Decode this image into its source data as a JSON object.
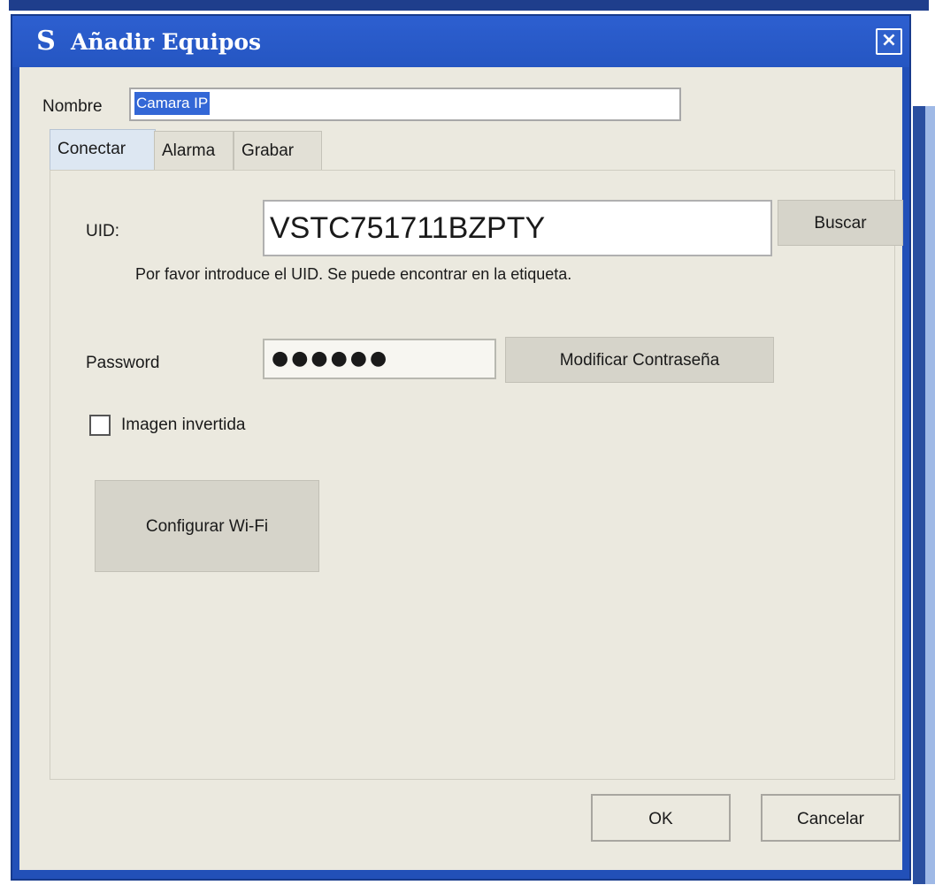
{
  "window": {
    "title": "Añadir Equipos",
    "app_icon": "S",
    "close_symbol": "×"
  },
  "form": {
    "name_label": "Nombre",
    "name_value": "Camara IP"
  },
  "tabs": [
    {
      "label": "Conectar",
      "active": true
    },
    {
      "label": "Alarma",
      "active": false
    },
    {
      "label": "Grabar",
      "active": false
    }
  ],
  "connect": {
    "uid_label": "UID:",
    "uid_value": "VSTC751711BZPTY",
    "search_label": "Buscar",
    "uid_hint": "Por favor introduce el UID. Se puede encontrar en la etiqueta.",
    "password_label": "Password",
    "password_mask": "●●●●●●",
    "change_password_label": "Modificar Contraseña",
    "invert_image_label": "Imagen invertida",
    "invert_image_checked": false,
    "wifi_label": "Configurar Wi-Fi"
  },
  "footer": {
    "ok_label": "OK",
    "cancel_label": "Cancelar"
  },
  "colors": {
    "titlebar": "#2556c2",
    "dialog_bg": "#ebe9df",
    "selection": "#3367d6"
  },
  "icons": {
    "app": "app-logo-icon",
    "close": "close-icon"
  }
}
